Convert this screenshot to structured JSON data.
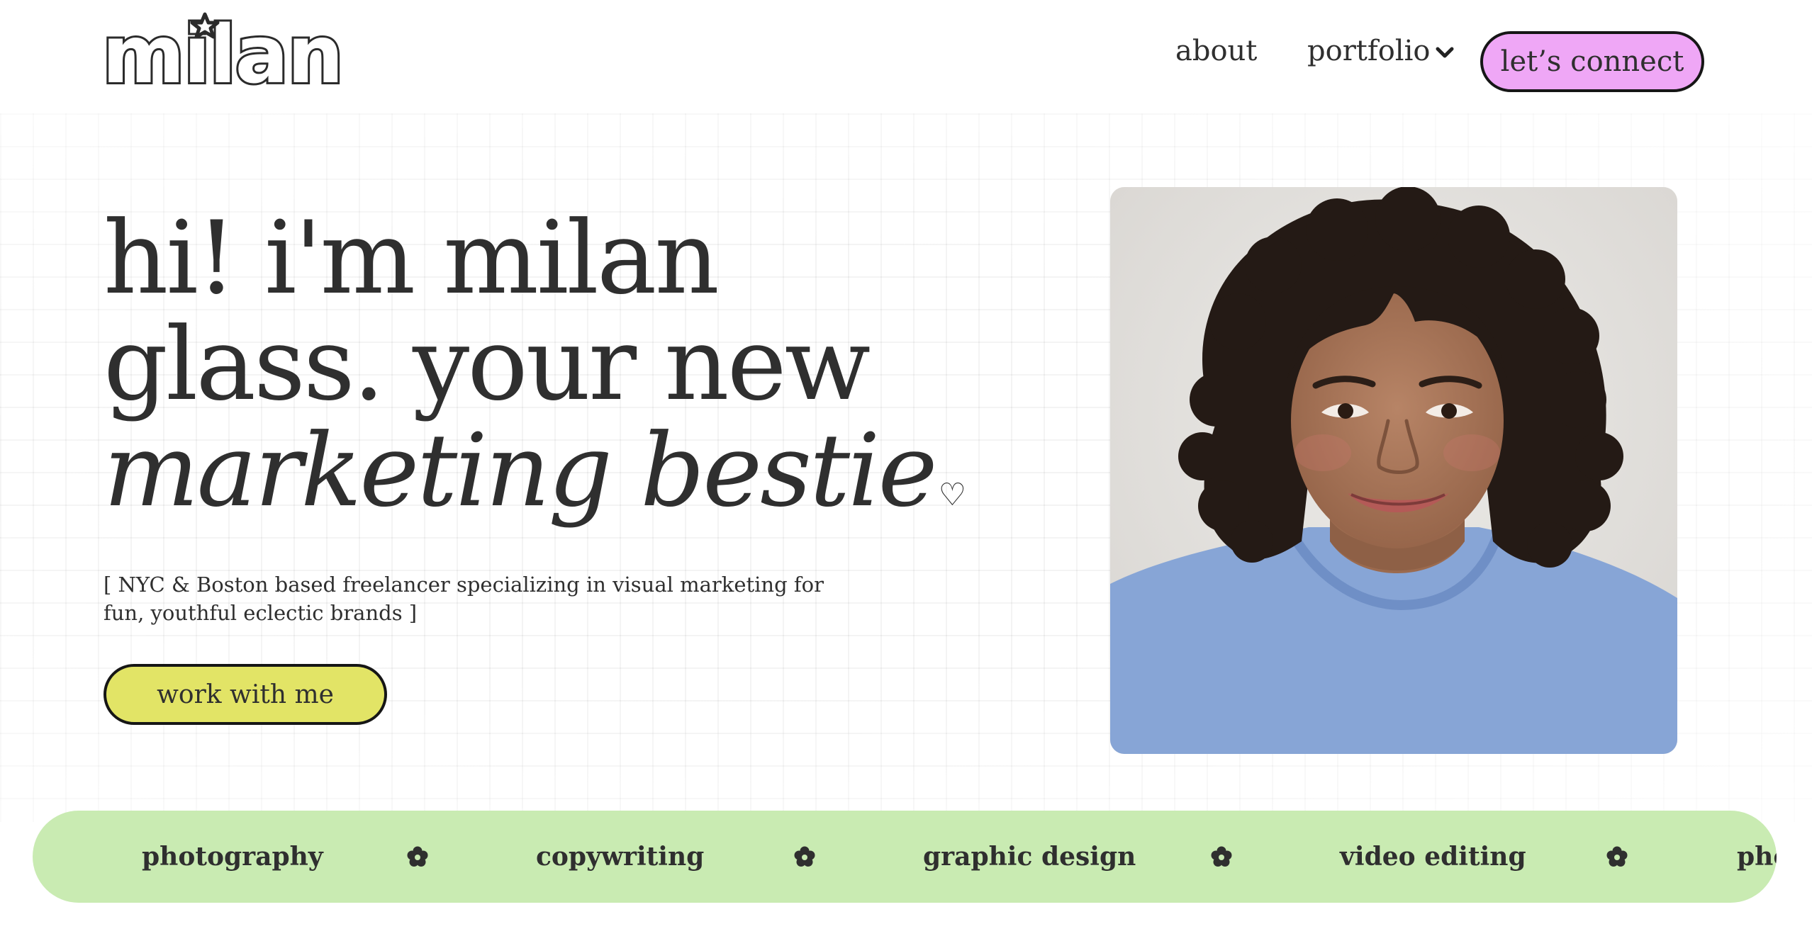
{
  "header": {
    "logo_text": "milan",
    "nav": {
      "about": "about",
      "portfolio": "portfolio",
      "connect": "let’s connect"
    }
  },
  "hero": {
    "title_line1": "hi! i'm milan",
    "title_line2": "glass. your new",
    "title_line3": "marketing bestie",
    "heart": "♡",
    "subtitle": "[ NYC & Boston based freelancer specializing in visual marketing for fun, youthful eclectic brands ]",
    "cta": "work with me"
  },
  "services": {
    "items": [
      "photography",
      "copywriting",
      "graphic design",
      "video editing",
      "pho"
    ]
  },
  "colors": {
    "connect_button": "#efa7f6",
    "cta_button": "#e2e466",
    "services_band": "#c9ebb2",
    "text": "#2f2f2f"
  },
  "icons": {
    "logo": "milan-logo",
    "portfolio_dropdown": "chevron-down-icon",
    "separator": "flower-icon"
  }
}
